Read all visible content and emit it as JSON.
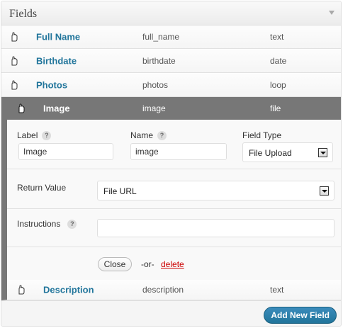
{
  "panel": {
    "title": "Fields"
  },
  "fields": [
    {
      "name": "Full Name",
      "key": "full_name",
      "type": "text"
    },
    {
      "name": "Birthdate",
      "key": "birthdate",
      "type": "date"
    },
    {
      "name": "Photos",
      "key": "photos",
      "type": "loop"
    }
  ],
  "active_field": {
    "name": "Image",
    "key": "image",
    "type": "file"
  },
  "editor": {
    "label_caption": "Label",
    "label_value": "Image",
    "name_caption": "Name",
    "name_value": "image",
    "field_type_caption": "Field Type",
    "field_type_value": "File Upload",
    "return_value_caption": "Return Value",
    "return_value_value": "File URL",
    "instructions_caption": "Instructions",
    "instructions_value": "",
    "help_glyph": "?",
    "close_label": "Close",
    "or_text": "-or-",
    "delete_label": "delete"
  },
  "sub_field": {
    "name": "Description",
    "key": "description",
    "type": "text"
  },
  "footer": {
    "add_label": "Add New Field"
  },
  "colors": {
    "accent": "#21759b",
    "active_row": "#777777",
    "delete": "#cc0000"
  },
  "icons": {
    "drag": "hand-drag-icon",
    "help": "help-icon",
    "collapse": "collapse-arrow-icon",
    "select": "dropdown-arrow-icon"
  }
}
